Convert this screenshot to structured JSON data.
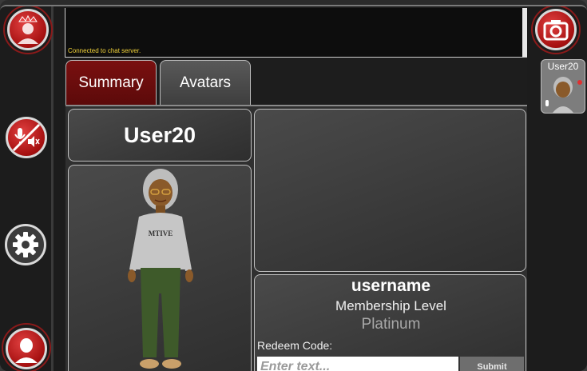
{
  "chat": {
    "message": "Connected to chat server."
  },
  "tabs": [
    {
      "label": "Summary"
    },
    {
      "label": "Avatars"
    }
  ],
  "profile": {
    "display_name": "User20",
    "username": "username",
    "membership_label": "Membership Level",
    "membership_value": "Platinum"
  },
  "redeem": {
    "label": "Redeem Code:",
    "placeholder": "Enter text...",
    "submit_label": "Submit"
  },
  "user_card": {
    "name": "User20"
  },
  "avatar": {
    "shirt_text": "MTIVE"
  },
  "icons": {
    "top_left": "crowned-user-icon",
    "mute": "muted-microphone-icon",
    "settings": "gear-icon",
    "profile": "user-silhouette-icon",
    "camera": "camera-icon"
  },
  "colors": {
    "accent_red": "#b01010",
    "chat_text": "#f2d33a"
  }
}
